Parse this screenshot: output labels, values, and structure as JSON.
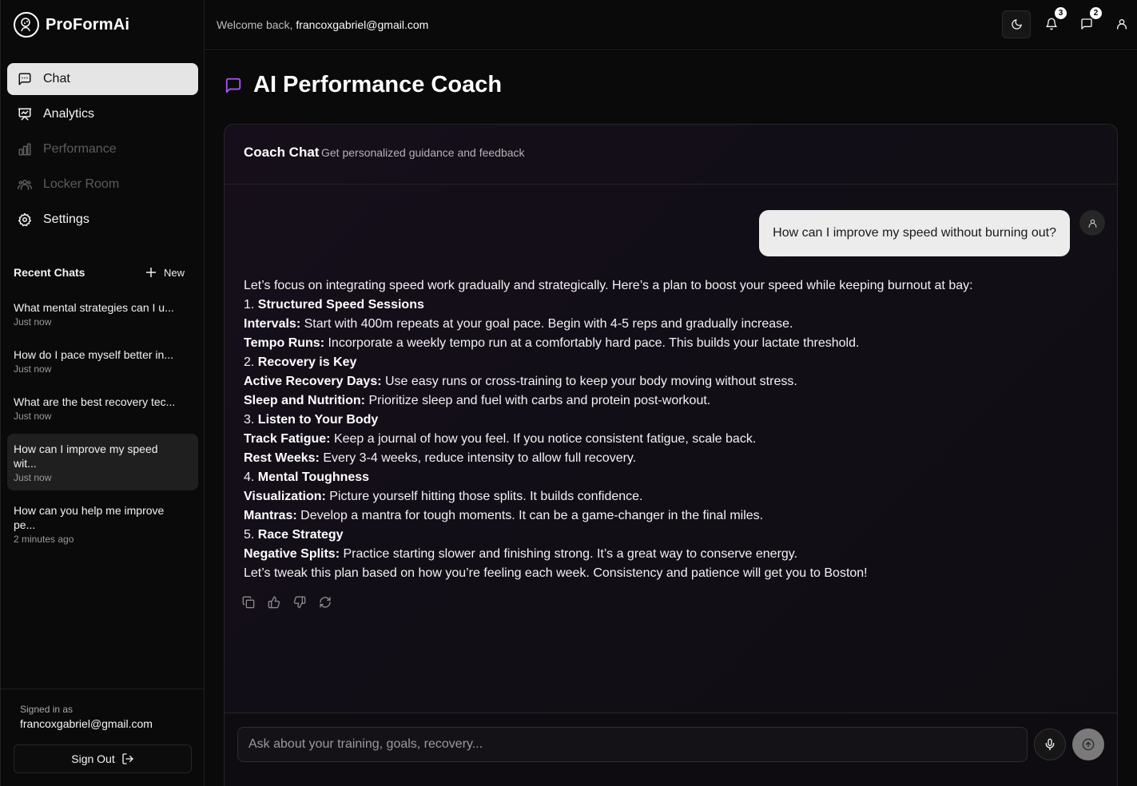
{
  "app": {
    "name": "ProFormAi"
  },
  "sidebar": {
    "nav": [
      {
        "label": "Chat",
        "icon": "message-square-icon",
        "active": true
      },
      {
        "label": "Analytics",
        "icon": "presentation-chart-icon"
      },
      {
        "label": "Performance",
        "icon": "bar-chart-icon",
        "disabled": true
      },
      {
        "label": "Locker Room",
        "icon": "users-icon",
        "disabled": true
      },
      {
        "label": "Settings",
        "icon": "gear-icon"
      }
    ],
    "recent_title": "Recent Chats",
    "new_label": "New",
    "chats": [
      {
        "title": "What mental strategies can I u...",
        "time": "Just now"
      },
      {
        "title": "How do I pace myself better in...",
        "time": "Just now"
      },
      {
        "title": "What are the best recovery tec...",
        "time": "Just now"
      },
      {
        "title": "How can I improve my speed wit...",
        "time": "Just now",
        "active": true
      },
      {
        "title": "How can you help me improve pe...",
        "time": "2 minutes ago"
      }
    ],
    "signed_in_label": "Signed in as",
    "signed_in_email": "francoxgabriel@gmail.com",
    "sign_out_label": "Sign Out"
  },
  "header": {
    "welcome_prefix": "Welcome back,",
    "welcome_email": "francoxgabriel@gmail.com",
    "notifications_count": "3",
    "messages_count": "2"
  },
  "main": {
    "title": "AI Performance Coach",
    "card_title": "Coach Chat",
    "card_subtitle": "Get personalized guidance and feedback",
    "user_message": "How can I improve my speed without burning out?",
    "answer": {
      "intro": "Let’s focus on integrating speed work gradually and strategically. Here’s a plan to boost your speed while keeping burnout at bay:",
      "l1_num": "1.",
      "l1": "Structured Speed Sessions",
      "l2_b": "Intervals:",
      "l2": "Start with 400m repeats at your goal pace. Begin with 4-5 reps and gradually increase.",
      "l3_b": "Tempo Runs:",
      "l3": "Incorporate a weekly tempo run at a comfortably hard pace. This builds your lactate threshold.",
      "l4_num": "2.",
      "l4": "Recovery is Key",
      "l5_b": "Active Recovery Days:",
      "l5": "Use easy runs or cross-training to keep your body moving without stress.",
      "l6_b": "Sleep and Nutrition:",
      "l6": "Prioritize sleep and fuel with carbs and protein post-workout.",
      "l7_num": "3.",
      "l7": "Listen to Your Body",
      "l8_b": "Track Fatigue:",
      "l8": "Keep a journal of how you feel. If you notice consistent fatigue, scale back.",
      "l9_b": "Rest Weeks:",
      "l9": "Every 3-4 weeks, reduce intensity to allow full recovery.",
      "l10_num": "4.",
      "l10": "Mental Toughness",
      "l11_b": "Visualization:",
      "l11": "Picture yourself hitting those splits. It builds confidence.",
      "l12_b": "Mantras:",
      "l12": "Develop a mantra for tough moments. It can be a game-changer in the final miles.",
      "l13_num": "5.",
      "l13": "Race Strategy",
      "l14_b": "Negative Splits:",
      "l14": "Practice starting slower and finishing strong. It’s a great way to conserve energy.",
      "outro": "Let’s tweak this plan based on how you’re feeling each week. Consistency and patience will get you to Boston!"
    },
    "input_placeholder": "Ask about your training, goals, recovery..."
  },
  "colors": {
    "accent": "#a855f7",
    "background": "#0a0a0a"
  }
}
